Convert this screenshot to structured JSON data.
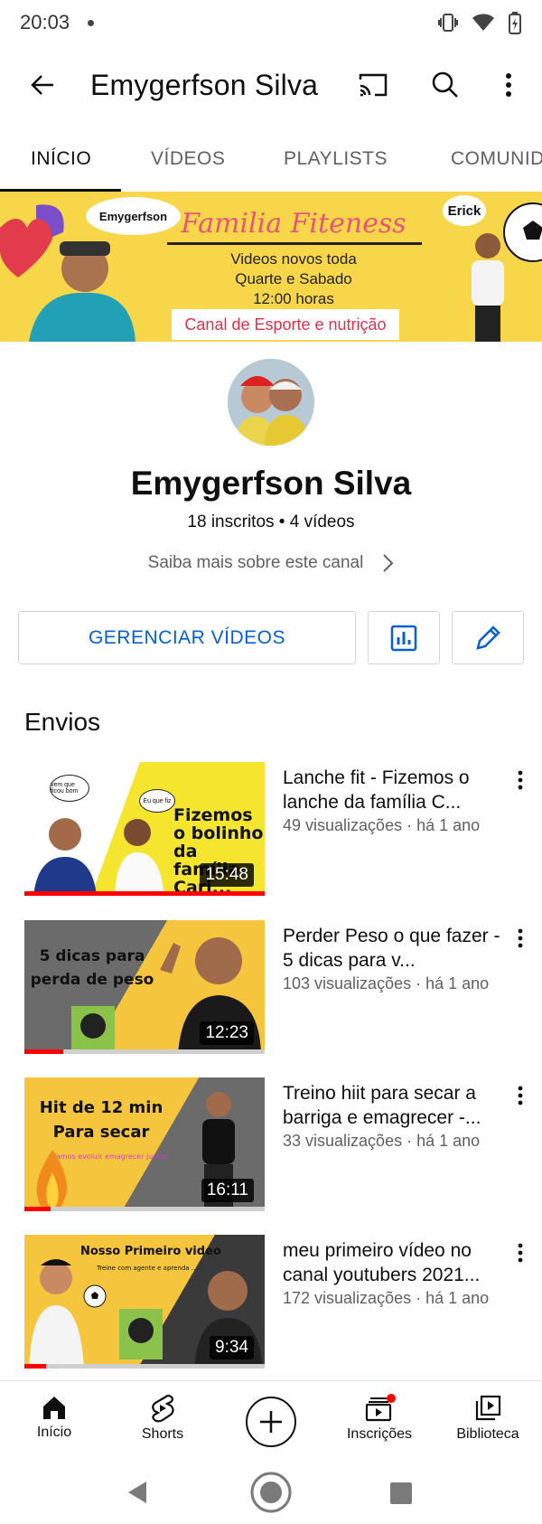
{
  "status_bar": {
    "time": "20:03"
  },
  "app_bar": {
    "title": "Emygerfson Silva"
  },
  "tabs": [
    {
      "label": "INÍCIO"
    },
    {
      "label": "VÍDEOS"
    },
    {
      "label": "PLAYLISTS"
    },
    {
      "label": "COMUNID"
    }
  ],
  "banner": {
    "bubble_left": "Emygerfson",
    "bubble_right": "Erick",
    "title": "Familia Fiteness",
    "lines": [
      "Videos novos toda",
      "Quarte e Sabado",
      "12:00 horas"
    ],
    "strip": "Canal de Esporte e nutrição"
  },
  "channel": {
    "name": "Emygerfson Silva",
    "stats": "18 inscritos • 4 vídeos",
    "about": "Saiba mais sobre este canal"
  },
  "actions": {
    "manage_label": "GERENCIAR VÍDEOS"
  },
  "uploads": {
    "title": "Envios",
    "videos": [
      {
        "title": "Lanche fit - Fizemos o lanche da família C...",
        "meta": "49 visualizações · há 1 ano",
        "duration": "15:48",
        "progress": 1.0,
        "thumb_text": "Fizemos o bolinho da família Cari...",
        "bubble1": "vem que ficou bom",
        "bubble2": "Eu que fiz"
      },
      {
        "title": "Perder Peso o que fazer - 5 dicas para v...",
        "meta": "103 visualizações · há 1 ano",
        "duration": "12:23",
        "progress": 0.16,
        "thumb_text": "5 dicas para perda de peso"
      },
      {
        "title": "Treino hiit para secar a barriga e emagrecer -...",
        "meta": "33 visualizações · há 1 ano",
        "duration": "16:11",
        "progress": 0.11,
        "thumb_text": "Hit de 12 min Para secar",
        "thumb_sub": "Vamos evoluir emagrecer juntos"
      },
      {
        "title": "meu primeiro vídeo no canal youtubers 2021...",
        "meta": "172 visualizações · há 1 ano",
        "duration": "9:34",
        "progress": 0.09,
        "thumb_text": "Nosso Primeiro video",
        "thumb_sub": "Treine com agente e aprenda ..."
      }
    ]
  },
  "bottom_nav": [
    {
      "label": "Início"
    },
    {
      "label": "Shorts"
    },
    {
      "label": "Inscrições"
    },
    {
      "label": "Biblioteca"
    }
  ],
  "colors": {
    "accent_blue": "#065fd4",
    "red": "#ff0000",
    "banner_yellow": "#f8d64a"
  }
}
